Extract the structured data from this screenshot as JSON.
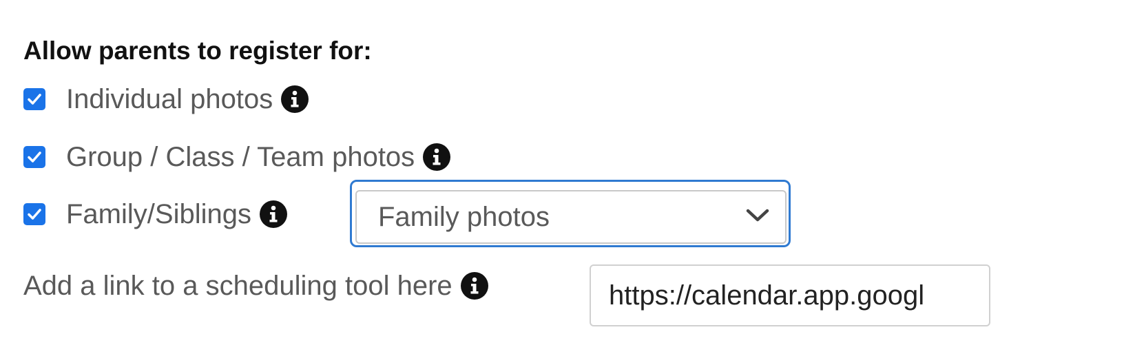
{
  "section": {
    "heading": "Allow parents to register for:"
  },
  "options": [
    {
      "label": "Individual photos",
      "checked": true,
      "icon": "info-icon"
    },
    {
      "label": "Group / Class / Team photos",
      "checked": true,
      "icon": "info-icon"
    },
    {
      "label": "Family/Siblings",
      "checked": true,
      "icon": "info-icon"
    }
  ],
  "family_select": {
    "value": "Family photos",
    "icon": "chevron-down-icon"
  },
  "scheduling": {
    "label": "Add a link to a scheduling tool here",
    "icon": "info-icon",
    "value": "https://calendar.app.googl"
  },
  "colors": {
    "checkbox": "#1a73e8",
    "focus_ring": "#2f7ad1",
    "info_icon": "#111111"
  }
}
